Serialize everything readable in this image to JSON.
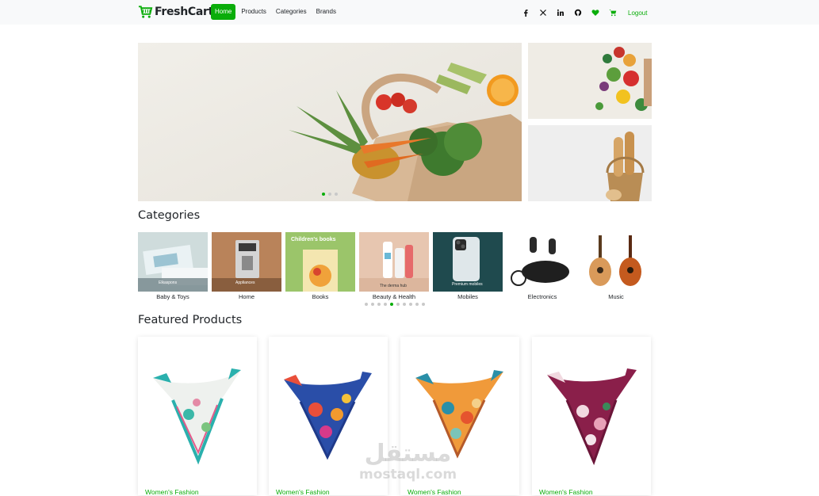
{
  "navbar": {
    "brand": "FreshCart",
    "links": [
      "Home",
      "Products",
      "Categories",
      "Brands"
    ],
    "active_link": "Home",
    "social_icons": [
      "facebook-icon",
      "x-twitter-icon",
      "linkedin-icon",
      "github-icon"
    ],
    "logout": "Logout"
  },
  "hero": {
    "slides_total": 3,
    "active_slide": 1
  },
  "categories": {
    "title": "Categories",
    "items": [
      {
        "label": "Baby & Toys",
        "caption": "Elkaspons"
      },
      {
        "label": "Home",
        "caption": "Appliances"
      },
      {
        "label": "Books",
        "caption": "Children's books"
      },
      {
        "label": "Beauty & Health",
        "caption": "The derma hub"
      },
      {
        "label": "Mobiles",
        "caption": "Premium mobiles"
      },
      {
        "label": "Electronics",
        "caption": ""
      },
      {
        "label": "Music",
        "caption": ""
      }
    ],
    "pages_total": 10,
    "active_page": 5
  },
  "featured": {
    "title": "Featured Products",
    "products": [
      {
        "category": "Women's Fashion"
      },
      {
        "category": "Women's Fashion"
      },
      {
        "category": "Women's Fashion"
      },
      {
        "category": "Women's Fashion"
      }
    ]
  },
  "watermark": {
    "arabic": "مستقل",
    "latin": "mostaql.com"
  },
  "colors": {
    "accent": "#0aad0a",
    "navbar_bg": "#f8f9fa",
    "text": "#212529"
  }
}
